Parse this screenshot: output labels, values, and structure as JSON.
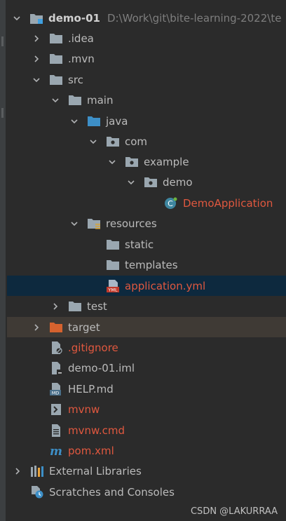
{
  "tree": {
    "root": {
      "label": "demo-01",
      "path": "D:\\Work\\git\\bite-learning-2022\\te"
    },
    "idea": ".idea",
    "mvn": ".mvn",
    "src": "src",
    "main": "main",
    "java": "java",
    "com": "com",
    "example": "example",
    "demo": "demo",
    "demo_application": "DemoApplication",
    "resources": "resources",
    "static": "static",
    "templates": "templates",
    "application_yml": "application.yml",
    "test": "test",
    "target": "target",
    "gitignore": ".gitignore",
    "demo_iml": "demo-01.iml",
    "help_md": "HELP.md",
    "mvnw": "mvnw",
    "mvnw_cmd": "mvnw.cmd",
    "pom_xml": "pom.xml",
    "external_libraries": "External Libraries",
    "scratches": "Scratches and Consoles"
  },
  "watermark": "CSDN @LAKURRAA",
  "icons": {
    "folder": "folder-icon",
    "module": "module-icon",
    "package": "package-icon",
    "resources": "resources-folder-icon",
    "excluded": "excluded-folder-icon",
    "class": "spring-class-icon",
    "yaml": "yml-file-icon",
    "markdown": "md-file-icon",
    "maven": "maven-icon"
  },
  "colors": {
    "background": "#2b2b2b",
    "selection": "#0d293e",
    "modified_text": "#e0583f",
    "excluded_row": "#3f3a35"
  }
}
